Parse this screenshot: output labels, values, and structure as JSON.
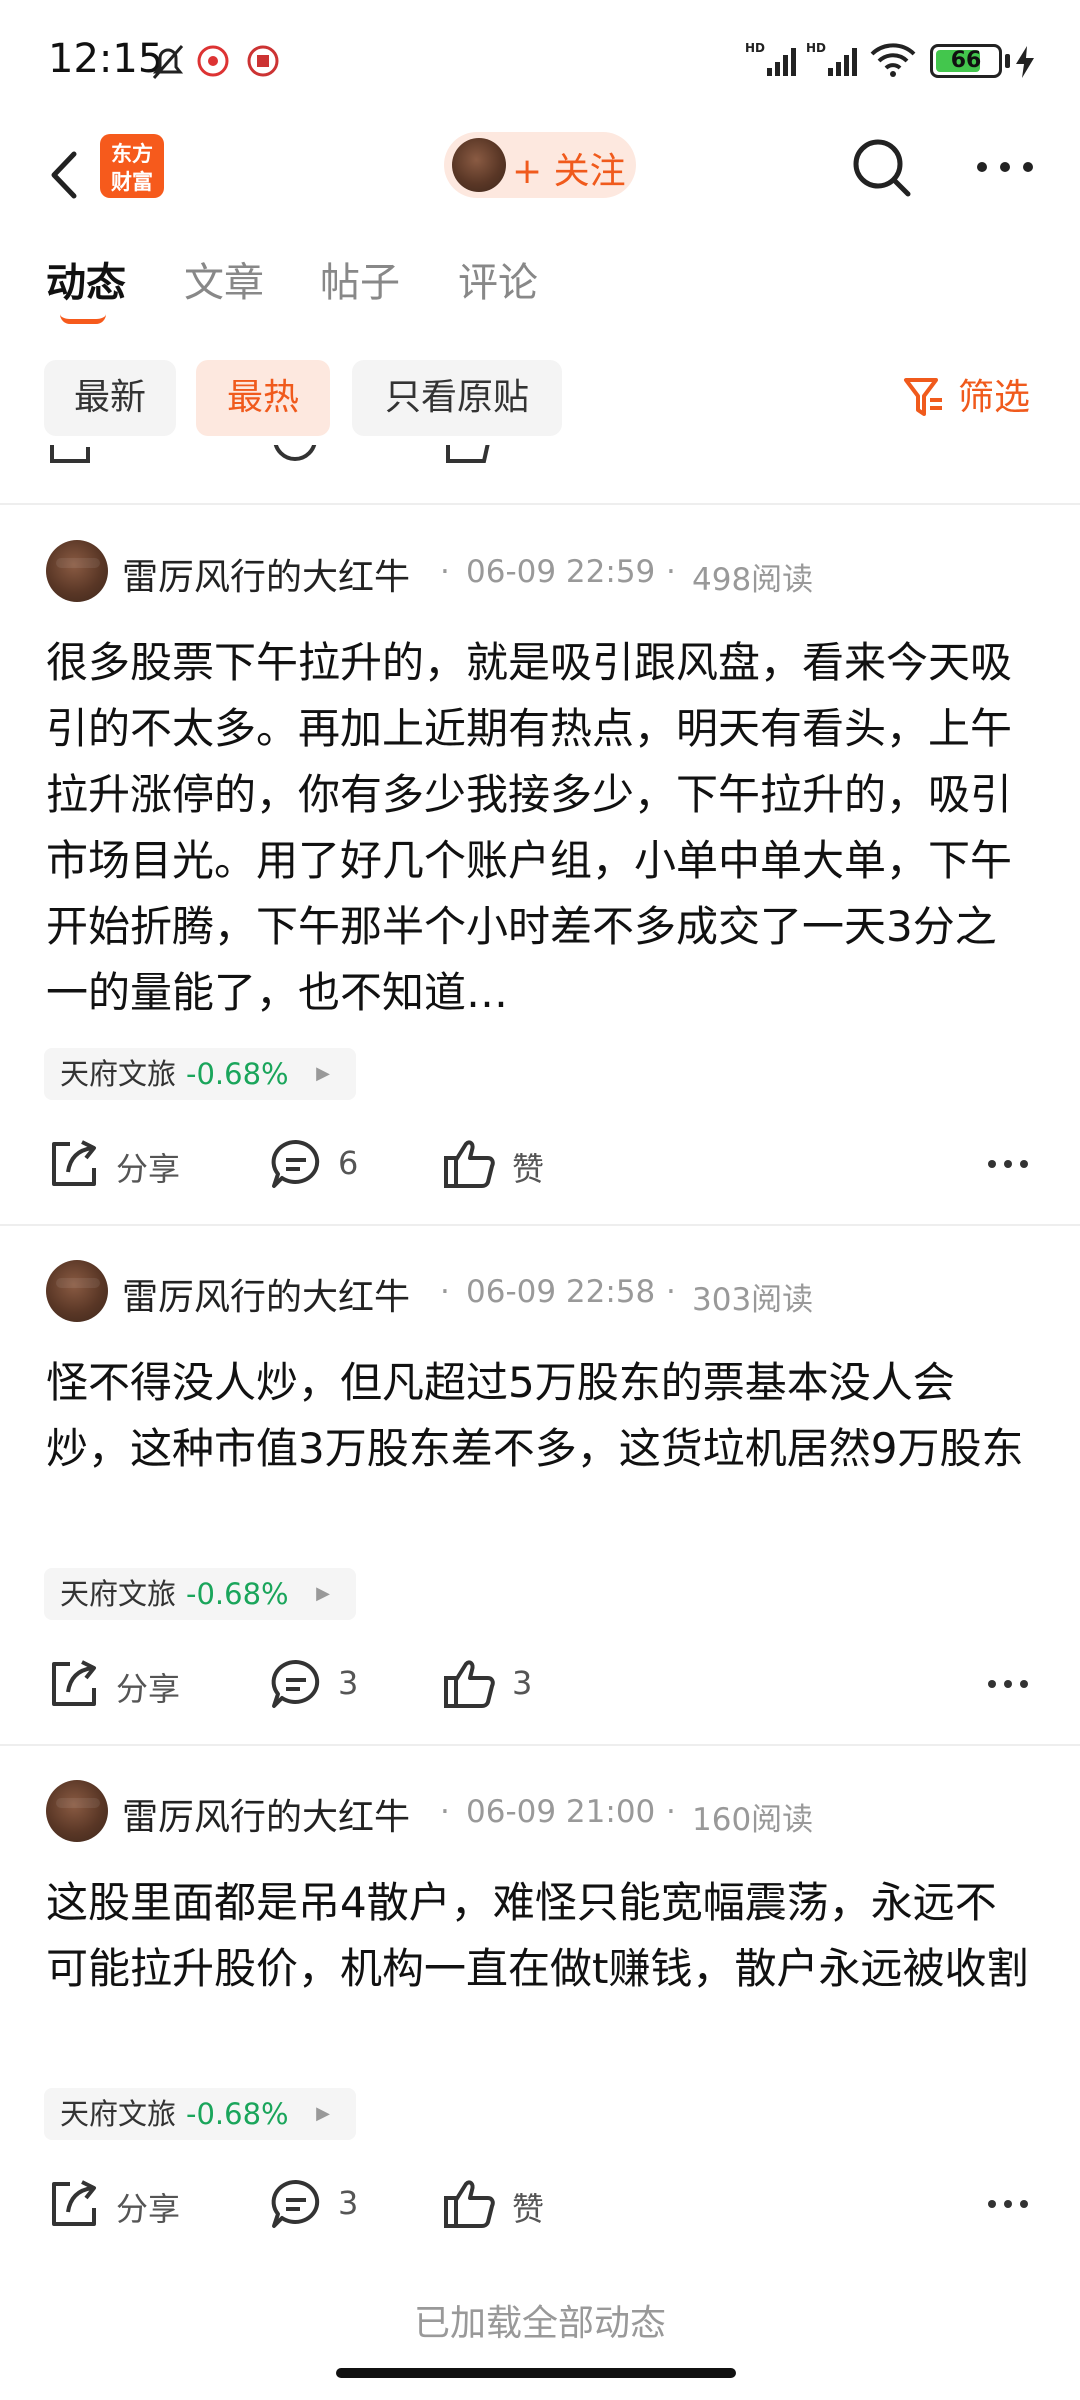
{
  "status_bar": {
    "time": "12:15",
    "battery": "66"
  },
  "header": {
    "logo_text": "东方财富",
    "follow_label": "+ 关注"
  },
  "tabs": [
    {
      "label": "动态"
    },
    {
      "label": "文章"
    },
    {
      "label": "帖子"
    },
    {
      "label": "评论"
    }
  ],
  "filters": {
    "chips": [
      {
        "label": "最新"
      },
      {
        "label": "最热"
      },
      {
        "label": "只看原贴"
      }
    ],
    "filter_label": "筛选"
  },
  "posts": [
    {
      "author": "雷厉风行的大红牛",
      "datetime": "06-09 22:59",
      "reads": "498阅读",
      "content": "很多股票下午拉升的，就是吸引跟风盘，看来今天吸引的不太多。再加上近期有热点，明天有看头，上午拉升涨停的，你有多少我接多少，下午拉升的，吸引市场目光。用了好几个账户组，小单中单大单，下午开始折腾，下午那半个小时差不多成交了一天3分之一的量能了，也不知道…",
      "stock": {
        "name": "天府文旅",
        "change": "-0.68%"
      },
      "share_label": "分享",
      "comment_count": "6",
      "like_label": "赞"
    },
    {
      "author": "雷厉风行的大红牛",
      "datetime": "06-09 22:58",
      "reads": "303阅读",
      "content": "怪不得没人炒，但凡超过5万股东的票基本没人会炒，这种市值3万股东差不多，这货垃机居然9万股东",
      "stock": {
        "name": "天府文旅",
        "change": "-0.68%"
      },
      "share_label": "分享",
      "comment_count": "3",
      "like_label": "3"
    },
    {
      "author": "雷厉风行的大红牛",
      "datetime": "06-09 21:00",
      "reads": "160阅读",
      "content": "这股里面都是吊4散户，难怪只能宽幅震荡，永远不可能拉升股价，机构一直在做t赚钱，散户永远被收割",
      "stock": {
        "name": "天府文旅",
        "change": "-0.68%"
      },
      "share_label": "分享",
      "comment_count": "3",
      "like_label": "赞"
    }
  ],
  "footer": {
    "text": "已加载全部动态"
  },
  "colors": {
    "accent": "#f65a1c",
    "stock_down": "#1aa55b"
  }
}
